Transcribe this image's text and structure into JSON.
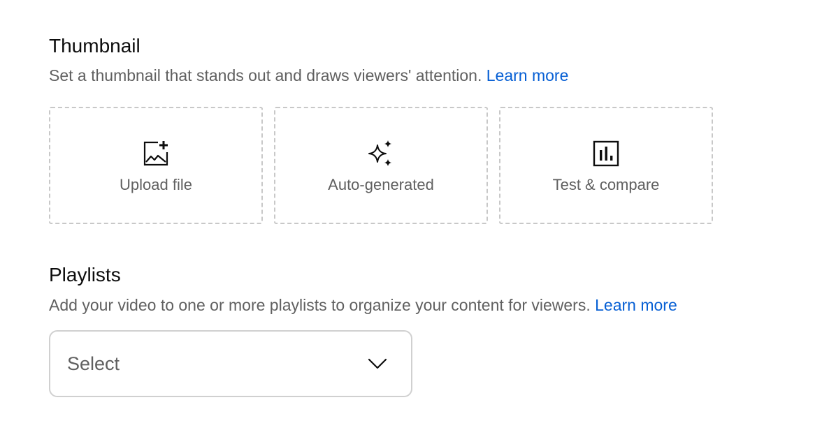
{
  "thumbnail": {
    "title": "Thumbnail",
    "description": "Set a thumbnail that stands out and draws viewers' attention.",
    "learn_more": "Learn more",
    "options": [
      {
        "label": "Upload file",
        "icon": "add-photo-icon"
      },
      {
        "label": "Auto-generated",
        "icon": "sparkle-icon"
      },
      {
        "label": "Test & compare",
        "icon": "bar-chart-icon"
      }
    ]
  },
  "playlists": {
    "title": "Playlists",
    "description": "Add your video to one or more playlists to organize your content for viewers.",
    "learn_more": "Learn more",
    "select": {
      "value": "Select",
      "icon": "chevron-down-icon"
    }
  },
  "colors": {
    "link": "#065fd4",
    "text_secondary": "#606060",
    "text_primary": "#0d0d0d",
    "dashed_border": "#c8c8c8"
  }
}
